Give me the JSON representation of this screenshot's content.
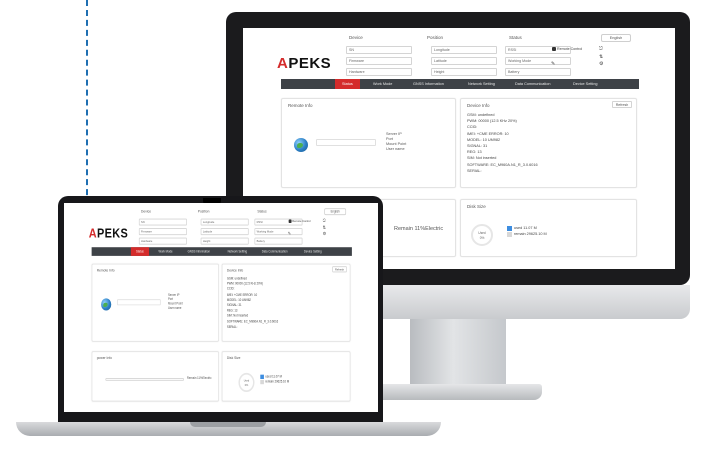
{
  "app": {
    "columns": [
      "Device",
      "Position",
      "Status"
    ],
    "language": "English",
    "logo": "APEKS",
    "fields": {
      "sn": "SN",
      "firmware": "Firmware",
      "hardware": "Hardware",
      "longitude": "Longitude",
      "latitude": "Latitude",
      "height": "Height",
      "rssi": "RSSI",
      "working_mode": "Working Mode",
      "battery": "Battery"
    },
    "remote_control": "Remote Control",
    "menu": [
      "Status",
      "Work Mode",
      "GNSS Information",
      "Network Setting",
      "Data Communication",
      "Device Setting"
    ],
    "remote_info_title": "Remote Info",
    "remote_items": [
      "Server IP",
      "Port",
      "Mount Point",
      "User name"
    ],
    "device_info_title": "Device Info",
    "refresh": "Refresh",
    "power_info_title": "power Info",
    "remain_text": "Remain 11%Electric",
    "disk_title": "Disk Size",
    "disk_used_label": "Used",
    "disk_used_pct": "0%",
    "legend_used": "used 11.07 M",
    "legend_remain": "remain 29625.10 M"
  },
  "monitor_device_info": [
    "GSM: undefined",
    "PWM: 00000 (12.5 KHz 20%)",
    "CCID:",
    "IMEI: +CME ERROR: 10",
    "MODEL: 10 UM982",
    "SIGNAL: 31",
    "REG: 13",
    "SIM: Not inserted",
    "SOFTWARE: EC_M960A.N1_R_3.0.6016",
    "SERIAL:"
  ],
  "laptop_device_info": [
    "GSM: undefined",
    "PWM: 00000 (12.5 KHz 20%)",
    "CCID:",
    "IMEI: +CME ERROR: 10",
    "MODEL: 10 UM982",
    "SIGNAL: 31",
    "REG: 13",
    "SIM: Not inserted",
    "SOFTWARE: EC_M960A.N1_R_3.0.6016",
    "SERIAL:"
  ],
  "colors": {
    "accent": "#d42b2b",
    "menubar": "#3e4247",
    "disk_used": "#3d8de0",
    "disk_remain": "#d8d8d8",
    "dashed_line": "#1f6fb2"
  }
}
